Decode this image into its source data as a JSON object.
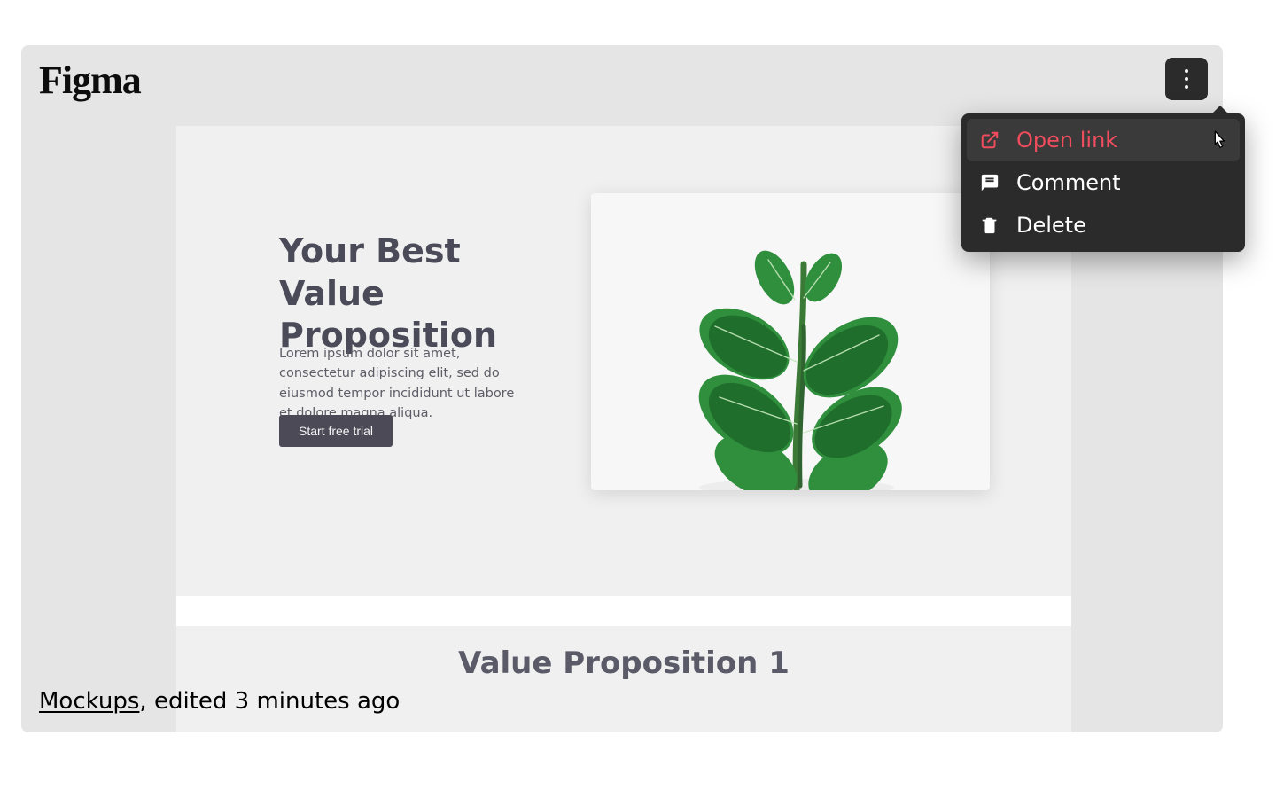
{
  "card": {
    "brand": "Figma",
    "caption_link": "Mockups",
    "caption_rest": ", edited 3 minutes ago"
  },
  "menu": {
    "open_link": "Open link",
    "comment": "Comment",
    "delete": "Delete"
  },
  "preview": {
    "hero_title": "Your Best Value Proposition",
    "hero_body": "Lorem ipsum dolor sit amet, consectetur adipiscing elit, sed do eiusmod tempor incididunt ut labore et dolore magna aliqua.",
    "cta_label": "Start free trial",
    "section2_title": "Value Proposition 1"
  },
  "colors": {
    "menu_bg": "#2b2b2b",
    "accent_danger": "#ef4d5d",
    "hero_text": "#4a4a58"
  }
}
